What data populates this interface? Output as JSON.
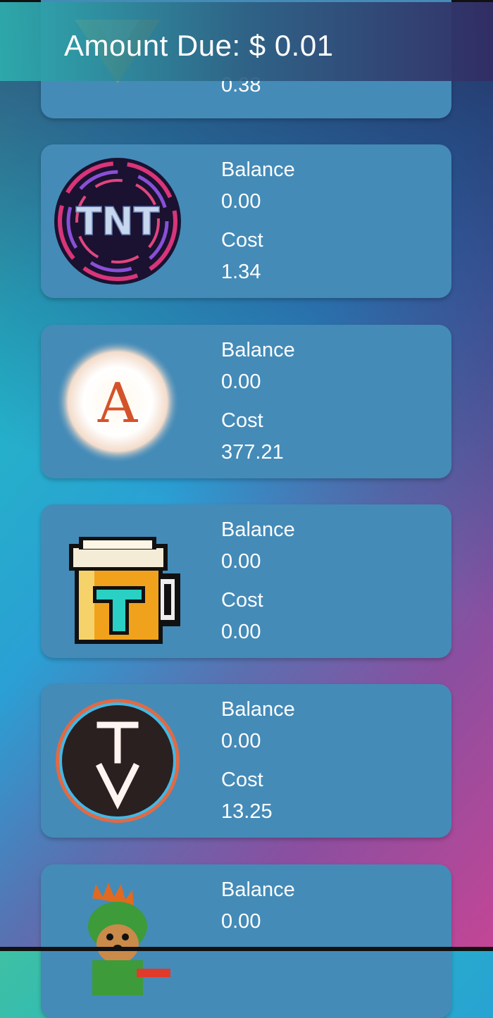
{
  "header": {
    "amount_due": "Amount Due: $ 0.01"
  },
  "cards": [
    {
      "logo": "diamond-gold-icon",
      "cost": "0.38"
    },
    {
      "logo": "tnt-logo",
      "balance_label": "Balance",
      "balance": "0.00",
      "cost_label": "Cost",
      "cost": "1.34"
    },
    {
      "logo": "glowing-a-logo",
      "balance_label": "Balance",
      "balance": "0.00",
      "cost_label": "Cost",
      "cost": "377.21"
    },
    {
      "logo": "beer-mug-t-logo",
      "balance_label": "Balance",
      "balance": "0.00",
      "cost_label": "Cost",
      "cost": "0.00"
    },
    {
      "logo": "tv-circle-logo",
      "balance_label": "Balance",
      "balance": "0.00",
      "cost_label": "Cost",
      "cost": "13.25"
    },
    {
      "logo": "dino-dog-logo",
      "balance_label": "Balance",
      "balance": "0.00"
    }
  ],
  "colors": {
    "card": "#448bb8",
    "text": "#ffffff"
  }
}
